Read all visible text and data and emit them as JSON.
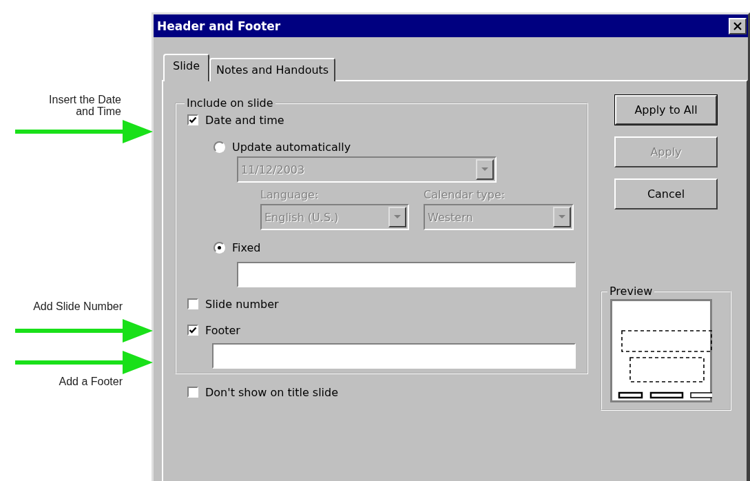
{
  "annotations": [
    {
      "text": "Insert the Date and Time"
    },
    {
      "text": "Add Slide Number"
    },
    {
      "text": "Add a Footer"
    }
  ],
  "window": {
    "title": "Header and Footer"
  },
  "tabs": [
    {
      "label": "Slide",
      "selected": true
    },
    {
      "label": "Notes and Handouts",
      "selected": false
    }
  ],
  "include_group": {
    "title": "Include on slide",
    "date_and_time": {
      "label": "Date and time",
      "checked": true
    },
    "update_automatically": {
      "label": "Update automatically",
      "selected": false,
      "date": {
        "value": "11/12/2003",
        "disabled": true
      },
      "language": {
        "label": "Language:",
        "value": "English (U.S.)",
        "disabled": true
      },
      "calendar_type": {
        "label": "Calendar type:",
        "value": "Western",
        "disabled": true
      }
    },
    "fixed": {
      "label": "Fixed",
      "selected": true
    },
    "slide_number": {
      "label": "Slide number",
      "checked": false
    },
    "footer": {
      "label": "Footer",
      "checked": true
    }
  },
  "dont_show_on_title_slide": {
    "label": "Don't show on title slide",
    "checked": false
  },
  "buttons": [
    {
      "label": "Apply to All",
      "disabled": false,
      "default": true
    },
    {
      "label": "Apply",
      "disabled": true,
      "default": false
    },
    {
      "label": "Cancel",
      "disabled": false,
      "default": false
    }
  ],
  "preview": {
    "title": "Preview"
  }
}
